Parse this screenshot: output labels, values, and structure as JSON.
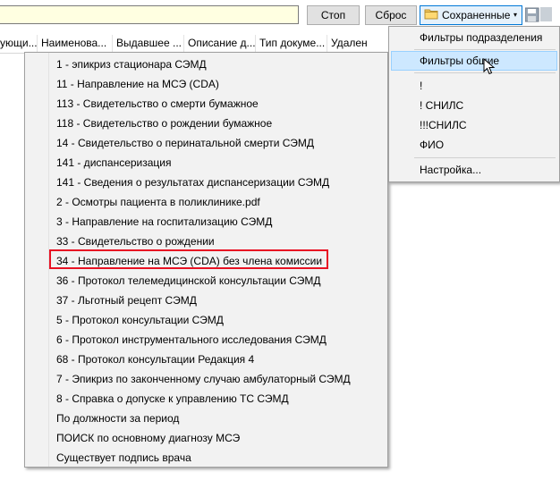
{
  "toolbar": {
    "stop_label": "Стоп",
    "reset_label": "Сброс",
    "saved_label": "Сохраненные",
    "saved_caret": "▾"
  },
  "columns": [
    "ующи...",
    "Наименова...",
    "Выдавшее ...",
    "Описание д...",
    "Тип докуме...",
    "Удален"
  ],
  "saved_menu": {
    "items": [
      "Фильтры подразделения",
      "Фильтры общие",
      "!",
      "! СНИЛС",
      "!!!СНИЛС",
      "ФИО",
      "Настройка..."
    ],
    "hovered_item": "Фильтры общие"
  },
  "filters_list": {
    "items": [
      "1 - эпикриз стационара СЭМД",
      "11 - Направление на МСЭ (CDA)",
      "113 - Свидетельство о смерти бумажное",
      "118 - Свидетельство о рождении бумажное",
      "14 - Свидетельство о перинатальной смерти СЭМД",
      "141 - диспансеризация",
      "141 - Сведения о результатах диспансеризации СЭМД",
      "2 - Осмотры пациента в поликлинике.pdf",
      "3 - Направление на госпитализацию СЭМД",
      "33 - Свидетельство о рождении",
      "34 - Направление на МСЭ (CDA) без члена комиссии",
      "36 - Протокол телемедицинской консультации СЭМД",
      "37 - Льготный рецепт СЭМД",
      "5 - Протокол консультации СЭМД",
      "6 - Протокол инструментального исследования СЭМД",
      "68 - Протокол консультации Редакция 4",
      "7 - Эпикриз по законченному случаю амбулаторный СЭМД",
      "8 - Справка о допуске к управлению ТС СЭМД",
      "По должности за период",
      "ПОИСК по основному диагнозу МСЭ",
      "Существует подпись врача"
    ],
    "highlighted_item": "34 - Направление на МСЭ (CDA) без члена комиссии",
    "highlight_color": "#e81123"
  },
  "colors": {
    "input_bg": "#ffffe1",
    "menu_bg": "#f2f2f2",
    "hover_bg": "#cde8ff",
    "saved_button_border": "#0078d7"
  },
  "icons": [
    "folder-icon",
    "chevron-down-icon",
    "save-icon",
    "mouse-cursor-icon"
  ]
}
